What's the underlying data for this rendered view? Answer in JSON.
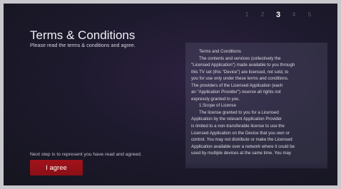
{
  "steps": {
    "items": [
      "1",
      "2",
      "3",
      "4",
      "5"
    ],
    "current": "3"
  },
  "title": "Terms & Conditions",
  "subtitle": "Please read the terms & conditions and agree.",
  "next_step_text": "Next step is to represent you have read and agreed.",
  "agree_button": "I agree",
  "terms": {
    "lines": [
      "Terms and Conditions",
      "The contents and services (collectively the",
      "\"Licensed Application\") made available to you through",
      "this TV set (this \"Device\") are licensed, not sold, to",
      "you for use only under these terms and conditions.",
      "The providers of the Licensed Application (each",
      "an \"Application Provider\") reserve all rights not",
      "expressly granted to you.",
      "1.Scope of License",
      "The license granted to you for a Licensed",
      "Application by the relevant Application Provider",
      "is limited to a non-transferable license to use the",
      "Licensed Application on the Device that you own or",
      "control. You may not distribute or make the Licensed",
      "Application available over a network where it could be",
      "used by multiple devices at the same time. You may"
    ]
  },
  "colors": {
    "accent_button": "#a3131b",
    "active_step": "#ffffff",
    "inactive_step": "#5d5a6a"
  }
}
